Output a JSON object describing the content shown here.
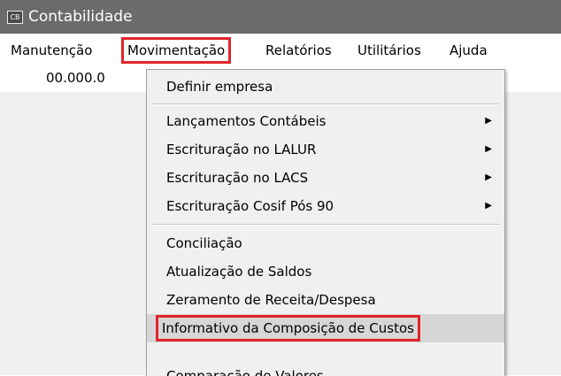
{
  "window": {
    "app_icon_text": "CB",
    "title": "Contabilidade"
  },
  "menubar": {
    "items": [
      "Manutenção",
      "Movimentação",
      "Relatórios",
      "Utilitários",
      "Ajuda"
    ],
    "active_index": 1
  },
  "field": {
    "value": "00.000.0"
  },
  "dropdown": {
    "items": [
      {
        "label": "Definir empresa",
        "submenu": false
      },
      {
        "label": "Lançamentos Contábeis",
        "submenu": true
      },
      {
        "label": "Escrituração no LALUR",
        "submenu": true
      },
      {
        "label": "Escrituração no LACS",
        "submenu": true
      },
      {
        "label": "Escrituração Cosif Pós 90",
        "submenu": true
      },
      {
        "label": "Conciliação",
        "submenu": false
      },
      {
        "label": "Atualização de Saldos",
        "submenu": false
      },
      {
        "label": "Zeramento de Receita/Despesa",
        "submenu": false
      },
      {
        "label": "Informativo da Composição de Custos",
        "submenu": false,
        "highlighted": true
      },
      {
        "label": "Comparação de Valores",
        "submenu": false,
        "partially_visible": true
      }
    ],
    "submenu_arrow": "▶"
  },
  "colors": {
    "highlight_border": "#e0252b",
    "titlebar": "#6b6b6b"
  }
}
